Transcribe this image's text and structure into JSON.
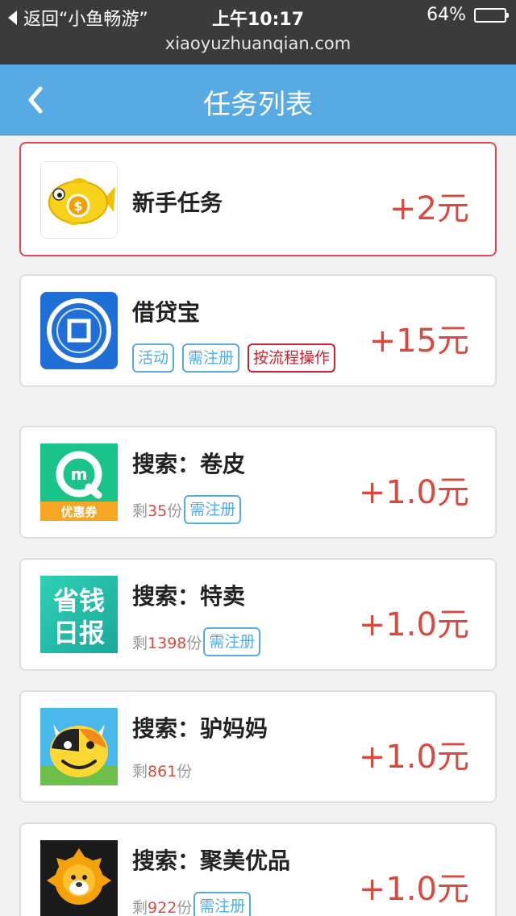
{
  "status_bar": {
    "back_text": "返回“小鱼畅游”",
    "time": "上午10:17",
    "battery": "64%",
    "battery_level": 0.64
  },
  "url": "xiaoyuzhuanqian.com",
  "nav": {
    "title": "任务列表"
  },
  "tasks": [
    {
      "title": "新手任务",
      "reward": "+2元"
    },
    {
      "title": "借贷宝",
      "reward": "+15元",
      "tags": [
        "活动",
        "需注册",
        "按流程操作"
      ]
    },
    {
      "title": "搜索：卷皮",
      "reward": "+1.0元",
      "remain_prefix": "剩",
      "remain_num": "35",
      "remain_suffix": "份",
      "tag": "需注册",
      "icon_text": "优惠券"
    },
    {
      "title": "搜索：特卖",
      "reward": "+1.0元",
      "remain_prefix": "剩",
      "remain_num": "1398",
      "remain_suffix": "份",
      "tag": "需注册",
      "icon_text_1": "省钱",
      "icon_text_2": "日报"
    },
    {
      "title": "搜索：驴妈妈",
      "reward": "+1.0元",
      "remain_prefix": "剩",
      "remain_num": "861",
      "remain_suffix": "份"
    },
    {
      "title": "搜索：聚美优品",
      "reward": "+1.0元",
      "remain_prefix": "剩",
      "remain_num": "922",
      "remain_suffix": "份",
      "tag": "需注册"
    }
  ],
  "colors": {
    "nav_bg": "#57aae2",
    "reward": "#d94a3e",
    "tag_blue": "#57aae2",
    "tag_red": "#c8232e",
    "highlight_border": "#e2474f"
  },
  "icons": [
    "back-chevron-icon",
    "goldfish-coin-icon",
    "jiedaibao-icon",
    "juanpi-icon",
    "shengqian-ribao-icon",
    "lvmama-cow-icon",
    "jumei-lion-icon"
  ]
}
